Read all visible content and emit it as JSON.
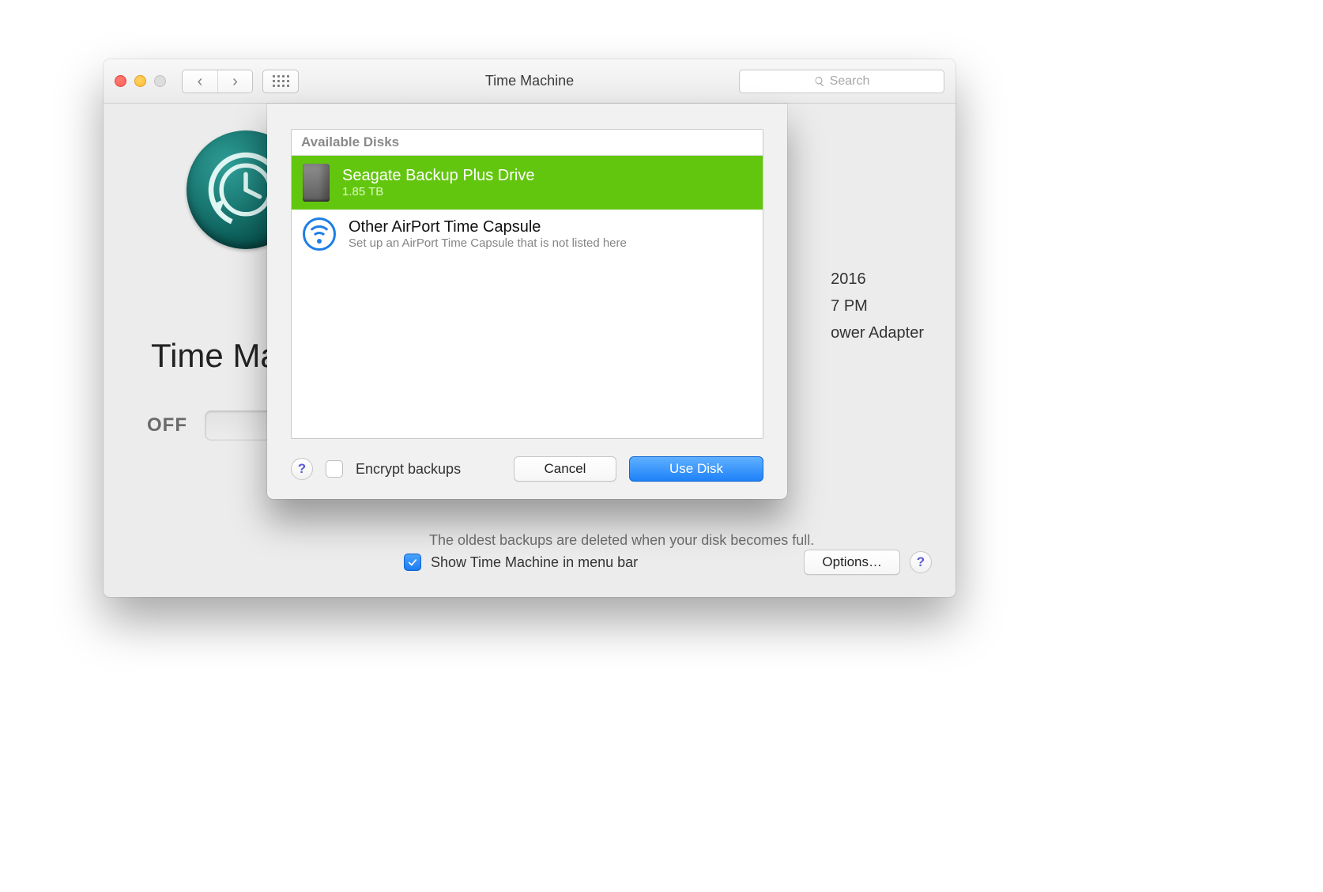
{
  "window": {
    "title": "Time Machine",
    "search_placeholder": "Search"
  },
  "main": {
    "app_label": "Time Ma",
    "toggle_state": "OFF",
    "info_line": "The oldest backups are deleted when your disk becomes full.",
    "side_info_1": "2016",
    "side_info_2": "7 PM",
    "side_info_3": "ower Adapter",
    "show_in_menu_bar_label": "Show Time Machine in menu bar",
    "options_label": "Options…"
  },
  "sheet": {
    "header": "Available Disks",
    "disks": [
      {
        "name": "Seagate Backup Plus Drive",
        "detail": "1.85 TB"
      },
      {
        "name": "Other AirPort Time Capsule",
        "detail": "Set up an AirPort Time Capsule that is not listed here"
      }
    ],
    "encrypt_label": "Encrypt backups",
    "cancel_label": "Cancel",
    "use_disk_label": "Use Disk"
  }
}
